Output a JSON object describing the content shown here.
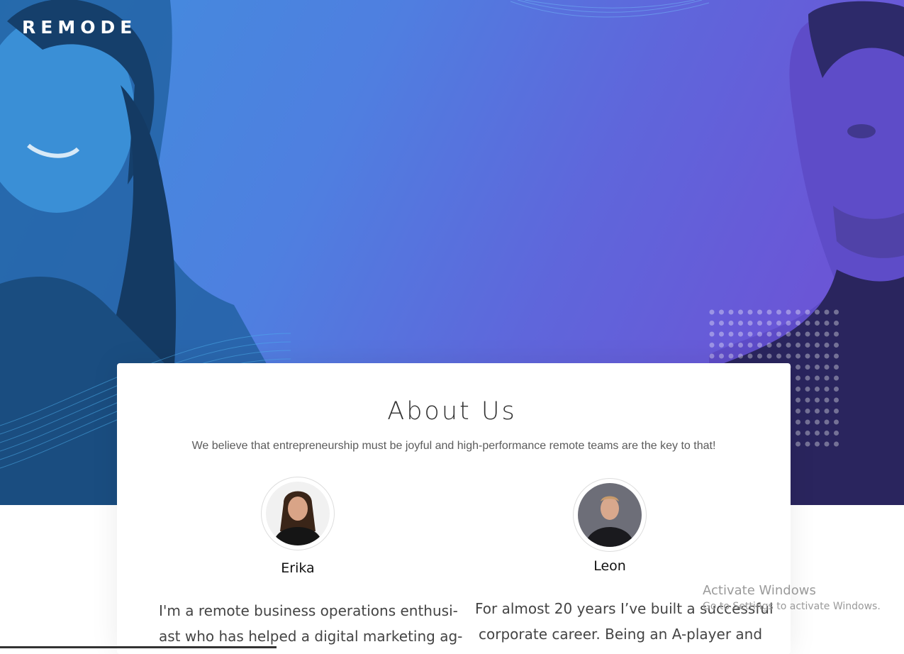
{
  "brand": {
    "logo_text": "REMODE"
  },
  "about": {
    "title": "About Us",
    "subtitle": "We believe that entrepreneurship must be joyful and high-performance remote teams are the key to that!"
  },
  "team": [
    {
      "name": "Erika",
      "bio_lines": [
        "I'm a remote business operations enthusi-",
        "ast who has helped a digital marketing ag-"
      ]
    },
    {
      "name": "Leon",
      "bio_lines": [
        "For almost 20 years I’ve built a successful",
        "corporate career. Being an A-player and"
      ]
    }
  ],
  "watermark": {
    "line1": "Activate Windows",
    "line2": "Go to Settings to activate Windows."
  },
  "colors": {
    "hero_start": "#3f8fdc",
    "hero_end": "#6c4fd3",
    "text_dark": "#333333"
  },
  "icons": [
    "dot-grid-decoration"
  ]
}
